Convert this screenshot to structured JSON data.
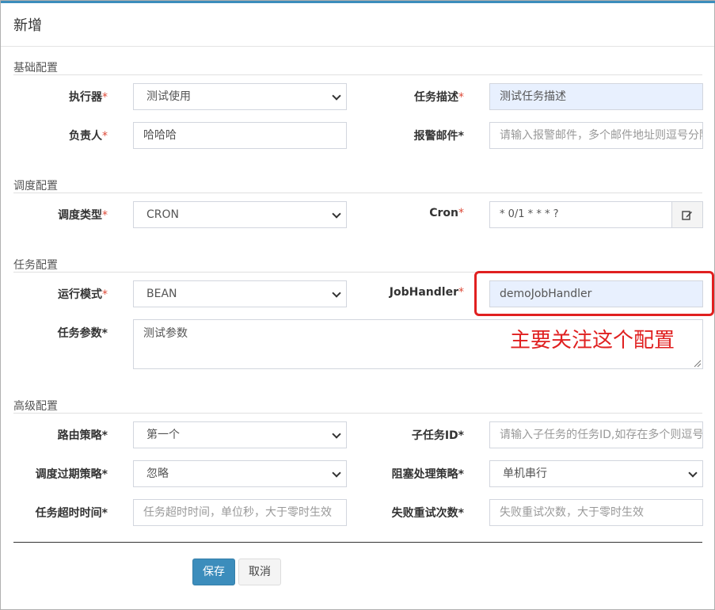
{
  "modal": {
    "title": "新增"
  },
  "sections": {
    "basic": "基础配置",
    "schedule": "调度配置",
    "task": "任务配置",
    "advanced": "高级配置"
  },
  "fields": {
    "executor": {
      "label": "执行器",
      "value": "测试使用"
    },
    "job_desc": {
      "label": "任务描述",
      "value": "测试任务描述"
    },
    "author": {
      "label": "负责人",
      "value": "哈哈哈"
    },
    "alarm_email": {
      "label": "报警邮件",
      "placeholder": "请输入报警邮件，多个邮件地址则逗号分隔"
    },
    "schedule_type": {
      "label": "调度类型",
      "value": "CRON"
    },
    "cron": {
      "label": "Cron",
      "value": "* 0/1 * * * ?"
    },
    "glue_type": {
      "label": "运行模式",
      "value": "BEAN"
    },
    "job_handler": {
      "label": "JobHandler",
      "value": "demoJobHandler"
    },
    "job_param": {
      "label": "任务参数",
      "value": "测试参数"
    },
    "route_strategy": {
      "label": "路由策略",
      "value": "第一个"
    },
    "child_job_id": {
      "label": "子任务ID",
      "placeholder": "请输入子任务的任务ID,如存在多个则逗号分隔"
    },
    "misfire_strategy": {
      "label": "调度过期策略",
      "value": "忽略"
    },
    "block_strategy": {
      "label": "阻塞处理策略",
      "value": "单机串行"
    },
    "timeout": {
      "label": "任务超时时间",
      "placeholder": "任务超时时间，单位秒，大于零时生效"
    },
    "fail_retry": {
      "label": "失败重试次数",
      "placeholder": "失败重试次数，大于零时生效"
    }
  },
  "required_mark": "*",
  "annotation": "主要关注这个配置",
  "buttons": {
    "save": "保存",
    "cancel": "取消"
  },
  "colors": {
    "primary": "#3c8dbc",
    "highlight": "#e02020",
    "required": "#dd4b39",
    "autofill": "#e8f0fe"
  },
  "icons": {
    "cron_edit": "edit-icon",
    "select": "chevron-down-icon"
  }
}
